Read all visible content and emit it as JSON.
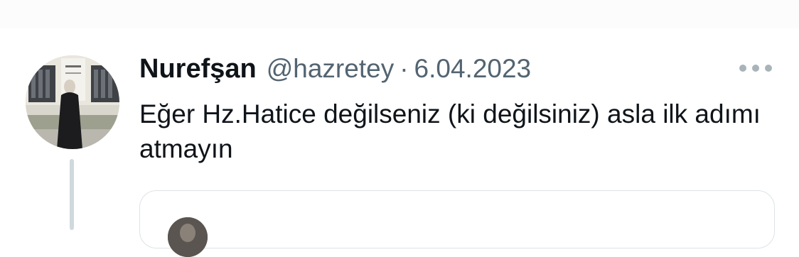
{
  "tweet": {
    "author_name": "Nurefşan",
    "author_handle": "@hazretey",
    "separator": "·",
    "date": "6.04.2023",
    "text": "Eğer Hz.Hatice değilseniz (ki değilsiniz) asla ilk adımı atmayın"
  },
  "icons": {
    "more": "more-horizontal-icon"
  },
  "colors": {
    "text_primary": "#0f1419",
    "text_secondary": "#536471",
    "thread_line": "#cfd9de",
    "card_border": "#dde3e7"
  }
}
